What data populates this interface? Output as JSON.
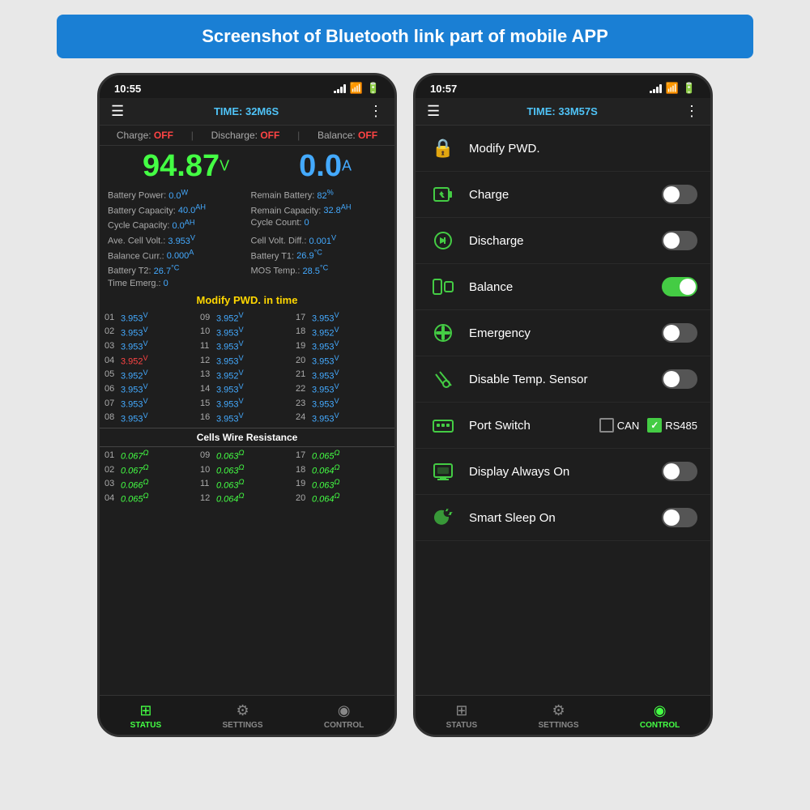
{
  "page": {
    "banner": "Screenshot of Bluetooth link part of mobile APP"
  },
  "phone_left": {
    "status_bar": {
      "time": "10:55"
    },
    "top_bar": {
      "time_label": "TIME: 32M6S"
    },
    "charge_status": {
      "charge_label": "Charge:",
      "charge_val": "OFF",
      "discharge_label": "Discharge:",
      "discharge_val": "OFF",
      "balance_label": "Balance:",
      "balance_val": "OFF"
    },
    "voltage": "94.87",
    "voltage_unit": "V",
    "current": "0.0",
    "current_unit": "A",
    "stats": [
      {
        "label": "Battery Power:",
        "val": "0.0",
        "unit": "W"
      },
      {
        "label": "Remain Battery:",
        "val": "82",
        "unit": "%"
      },
      {
        "label": "Battery Capacity:",
        "val": "40.0",
        "unit": "AH"
      },
      {
        "label": "Remain Capacity:",
        "val": "32.8",
        "unit": "AH"
      },
      {
        "label": "Cycle Capacity:",
        "val": "0.0",
        "unit": "AH"
      },
      {
        "label": "Cycle Count:",
        "val": "0",
        "unit": ""
      },
      {
        "label": "Ave. Cell Volt.:",
        "val": "3.953",
        "unit": "V"
      },
      {
        "label": "Cell Volt. Diff.:",
        "val": "0.001",
        "unit": "V"
      },
      {
        "label": "Balance Curr.:",
        "val": "0.000",
        "unit": "A"
      },
      {
        "label": "Battery T1:",
        "val": "26.9",
        "unit": "°C"
      },
      {
        "label": "Battery T2:",
        "val": "26.7",
        "unit": "°C"
      },
      {
        "label": "MOS Temp.:",
        "val": "28.5",
        "unit": "°C"
      },
      {
        "label": "Time Emerg.:",
        "val": "0",
        "unit": ""
      }
    ],
    "modify_label": "Modify PWD. in time",
    "cells": [
      {
        "num": "01",
        "val": "3.953",
        "red": false
      },
      {
        "num": "09",
        "val": "3.952",
        "red": false
      },
      {
        "num": "17",
        "val": "3.953",
        "red": false
      },
      {
        "num": "02",
        "val": "3.953",
        "red": false
      },
      {
        "num": "10",
        "val": "3.953",
        "red": false
      },
      {
        "num": "18",
        "val": "3.952",
        "red": false
      },
      {
        "num": "03",
        "val": "3.953",
        "red": false
      },
      {
        "num": "11",
        "val": "3.953",
        "red": false
      },
      {
        "num": "19",
        "val": "3.953",
        "red": false
      },
      {
        "num": "04",
        "val": "3.952",
        "red": true
      },
      {
        "num": "12",
        "val": "3.953",
        "red": false
      },
      {
        "num": "20",
        "val": "3.953",
        "red": false
      },
      {
        "num": "05",
        "val": "3.952",
        "red": false
      },
      {
        "num": "13",
        "val": "3.952",
        "red": false
      },
      {
        "num": "21",
        "val": "3.953",
        "red": false
      },
      {
        "num": "06",
        "val": "3.953",
        "red": false
      },
      {
        "num": "14",
        "val": "3.953",
        "red": false
      },
      {
        "num": "22",
        "val": "3.953",
        "red": false
      },
      {
        "num": "07",
        "val": "3.953",
        "red": false
      },
      {
        "num": "15",
        "val": "3.953",
        "red": false
      },
      {
        "num": "23",
        "val": "3.953",
        "red": false
      },
      {
        "num": "08",
        "val": "3.953",
        "red": false
      },
      {
        "num": "16",
        "val": "3.953",
        "red": false
      },
      {
        "num": "24",
        "val": "3.953",
        "red": false
      }
    ],
    "resistance_label": "Cells Wire Resistance",
    "resistances": [
      {
        "num": "01",
        "val": "0.067"
      },
      {
        "num": "09",
        "val": "0.063"
      },
      {
        "num": "17",
        "val": "0.065"
      },
      {
        "num": "02",
        "val": "0.067"
      },
      {
        "num": "10",
        "val": "0.063"
      },
      {
        "num": "18",
        "val": "0.064"
      },
      {
        "num": "03",
        "val": "0.066"
      },
      {
        "num": "11",
        "val": "0.063"
      },
      {
        "num": "19",
        "val": "0.063"
      },
      {
        "num": "04",
        "val": "0.065"
      },
      {
        "num": "12",
        "val": "0.064"
      },
      {
        "num": "20",
        "val": "0.064"
      }
    ],
    "nav": [
      {
        "label": "STATUS",
        "icon": "⊞",
        "active": true
      },
      {
        "label": "SETTINGS",
        "icon": "⚙",
        "active": false
      },
      {
        "label": "CONTROL",
        "icon": "◉",
        "active": false
      }
    ]
  },
  "phone_right": {
    "status_bar": {
      "time": "10:57"
    },
    "top_bar": {
      "time_label": "TIME: 33M57S"
    },
    "controls": [
      {
        "id": "modify-pwd",
        "label": "Modify PWD.",
        "icon": "🔒",
        "type": "none",
        "toggle": null
      },
      {
        "id": "charge",
        "label": "Charge",
        "icon": "🔋",
        "type": "toggle",
        "toggle": false
      },
      {
        "id": "discharge",
        "label": "Discharge",
        "icon": "♻",
        "type": "toggle",
        "toggle": false
      },
      {
        "id": "balance",
        "label": "Balance",
        "icon": "🔋",
        "type": "toggle",
        "toggle": true
      },
      {
        "id": "emergency",
        "label": "Emergency",
        "icon": "⚡",
        "type": "toggle",
        "toggle": false
      },
      {
        "id": "disable-temp",
        "label": "Disable Temp. Sensor",
        "icon": "🌡",
        "type": "toggle",
        "toggle": false
      },
      {
        "id": "port-switch",
        "label": "Port Switch",
        "icon": "⌨",
        "type": "port",
        "can": false,
        "rs485": true
      },
      {
        "id": "display-always",
        "label": "Display Always On",
        "icon": "🖥",
        "type": "toggle",
        "toggle": false
      },
      {
        "id": "smart-sleep",
        "label": "Smart Sleep On",
        "icon": "🌙",
        "type": "toggle",
        "toggle": false
      }
    ],
    "nav": [
      {
        "label": "STATUS",
        "icon": "⊞",
        "active": false
      },
      {
        "label": "SETTINGS",
        "icon": "⚙",
        "active": false
      },
      {
        "label": "CONTROL",
        "icon": "◉",
        "active": true
      }
    ]
  }
}
